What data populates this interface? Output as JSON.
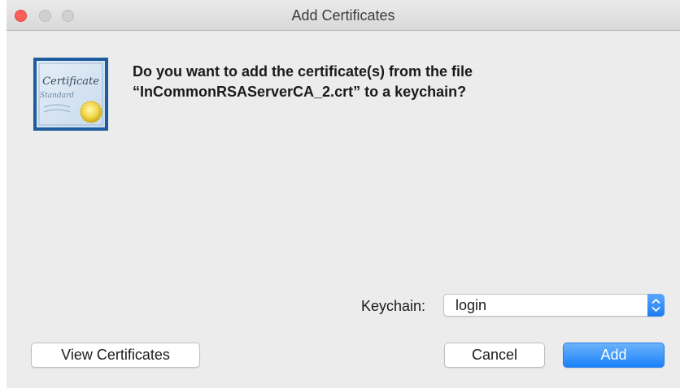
{
  "window": {
    "title": "Add Certificates"
  },
  "message": {
    "line1": "Do you want to add the certificate(s) from the file",
    "line2": "“InCommonRSAServerCA_2.crt” to a keychain?"
  },
  "certificate_icon": {
    "script_text": "Certificate",
    "sub_text": "Standard"
  },
  "keychain": {
    "label": "Keychain:",
    "selected": "login"
  },
  "buttons": {
    "view_certificates": "View Certificates",
    "cancel": "Cancel",
    "add": "Add"
  },
  "icons": {
    "close": "close-icon",
    "minimize": "minimize-icon",
    "maximize": "maximize-icon",
    "certificate": "certificate-icon",
    "stepper": "up-down-chevron-icon"
  },
  "colors": {
    "accent": "#1a82fb",
    "close": "#fc5f57",
    "background": "#ececec"
  }
}
